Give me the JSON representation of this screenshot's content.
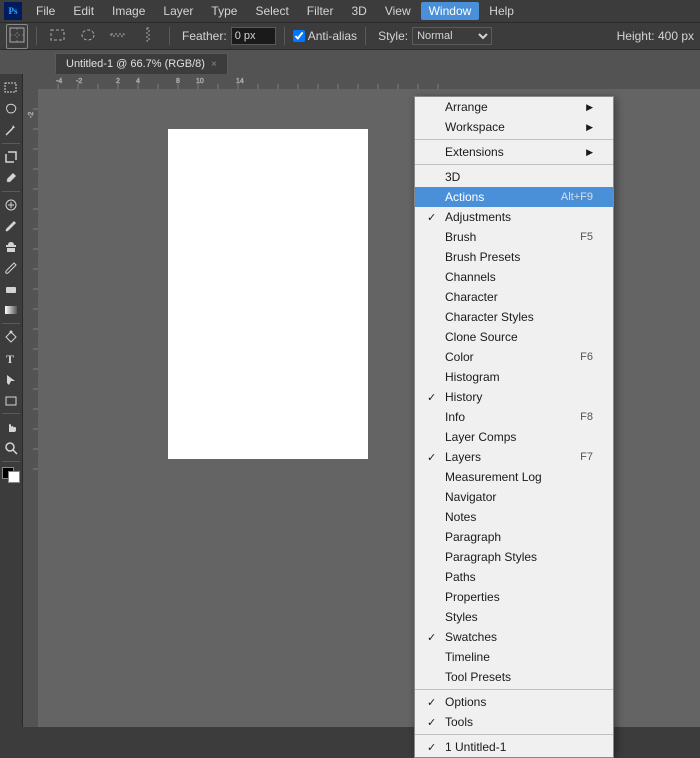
{
  "app": {
    "title": "Adobe Photoshop"
  },
  "menubar": {
    "items": [
      "PS",
      "File",
      "Edit",
      "Image",
      "Layer",
      "Type",
      "Select",
      "Filter",
      "3D",
      "View",
      "Window",
      "Help"
    ],
    "active": "Window"
  },
  "toolbar": {
    "feather_label": "Feather:",
    "feather_value": "0 px",
    "antialias_label": "Anti-alias",
    "style_label": "Style:",
    "height_label": "Height: 400 px"
  },
  "tab": {
    "title": "Untitled-1 @ 66.7% (RGB/8)",
    "close_icon": "×"
  },
  "window_menu": {
    "items": [
      {
        "label": "Arrange",
        "has_submenu": true,
        "checked": false,
        "shortcut": ""
      },
      {
        "label": "Workspace",
        "has_submenu": true,
        "checked": false,
        "shortcut": ""
      },
      {
        "label": "",
        "separator": true
      },
      {
        "label": "Extensions",
        "has_submenu": true,
        "checked": false,
        "shortcut": ""
      },
      {
        "label": "",
        "separator": true
      },
      {
        "label": "3D",
        "has_submenu": false,
        "checked": false,
        "shortcut": ""
      },
      {
        "label": "Actions",
        "has_submenu": false,
        "checked": false,
        "shortcut": "Alt+F9",
        "highlighted": true
      },
      {
        "label": "Adjustments",
        "has_submenu": false,
        "checked": true,
        "shortcut": ""
      },
      {
        "label": "Brush",
        "has_submenu": false,
        "checked": false,
        "shortcut": "F5"
      },
      {
        "label": "Brush Presets",
        "has_submenu": false,
        "checked": false,
        "shortcut": ""
      },
      {
        "label": "Channels",
        "has_submenu": false,
        "checked": false,
        "shortcut": ""
      },
      {
        "label": "Character",
        "has_submenu": false,
        "checked": false,
        "shortcut": ""
      },
      {
        "label": "Character Styles",
        "has_submenu": false,
        "checked": false,
        "shortcut": ""
      },
      {
        "label": "Clone Source",
        "has_submenu": false,
        "checked": false,
        "shortcut": ""
      },
      {
        "label": "Color",
        "has_submenu": false,
        "checked": false,
        "shortcut": "F6"
      },
      {
        "label": "Histogram",
        "has_submenu": false,
        "checked": false,
        "shortcut": ""
      },
      {
        "label": "History",
        "has_submenu": false,
        "checked": true,
        "shortcut": ""
      },
      {
        "label": "Info",
        "has_submenu": false,
        "checked": false,
        "shortcut": "F8"
      },
      {
        "label": "Layer Comps",
        "has_submenu": false,
        "checked": false,
        "shortcut": ""
      },
      {
        "label": "Layers",
        "has_submenu": false,
        "checked": true,
        "shortcut": "F7"
      },
      {
        "label": "Measurement Log",
        "has_submenu": false,
        "checked": false,
        "shortcut": ""
      },
      {
        "label": "Navigator",
        "has_submenu": false,
        "checked": false,
        "shortcut": ""
      },
      {
        "label": "Notes",
        "has_submenu": false,
        "checked": false,
        "shortcut": ""
      },
      {
        "label": "Paragraph",
        "has_submenu": false,
        "checked": false,
        "shortcut": ""
      },
      {
        "label": "Paragraph Styles",
        "has_submenu": false,
        "checked": false,
        "shortcut": ""
      },
      {
        "label": "Paths",
        "has_submenu": false,
        "checked": false,
        "shortcut": ""
      },
      {
        "label": "Properties",
        "has_submenu": false,
        "checked": false,
        "shortcut": ""
      },
      {
        "label": "Styles",
        "has_submenu": false,
        "checked": false,
        "shortcut": ""
      },
      {
        "label": "Swatches",
        "has_submenu": false,
        "checked": true,
        "shortcut": ""
      },
      {
        "label": "Timeline",
        "has_submenu": false,
        "checked": false,
        "shortcut": ""
      },
      {
        "label": "Tool Presets",
        "has_submenu": false,
        "checked": false,
        "shortcut": ""
      },
      {
        "label": "",
        "separator": true
      },
      {
        "label": "Options",
        "has_submenu": false,
        "checked": true,
        "shortcut": ""
      },
      {
        "label": "Tools",
        "has_submenu": false,
        "checked": true,
        "shortcut": ""
      },
      {
        "label": "",
        "separator": true
      },
      {
        "label": "1 Untitled-1",
        "has_submenu": false,
        "checked": true,
        "shortcut": ""
      }
    ]
  },
  "tools": {
    "buttons": [
      "M",
      "M",
      "L",
      "L",
      "⊕",
      "⊕",
      "✂",
      "✂",
      "⬡",
      "⌐",
      "⌐",
      "J",
      "B",
      "S",
      "E",
      "G",
      "⌫",
      "P",
      "T",
      "↗",
      "↗",
      "🔍",
      "🖐",
      "🖐"
    ]
  }
}
